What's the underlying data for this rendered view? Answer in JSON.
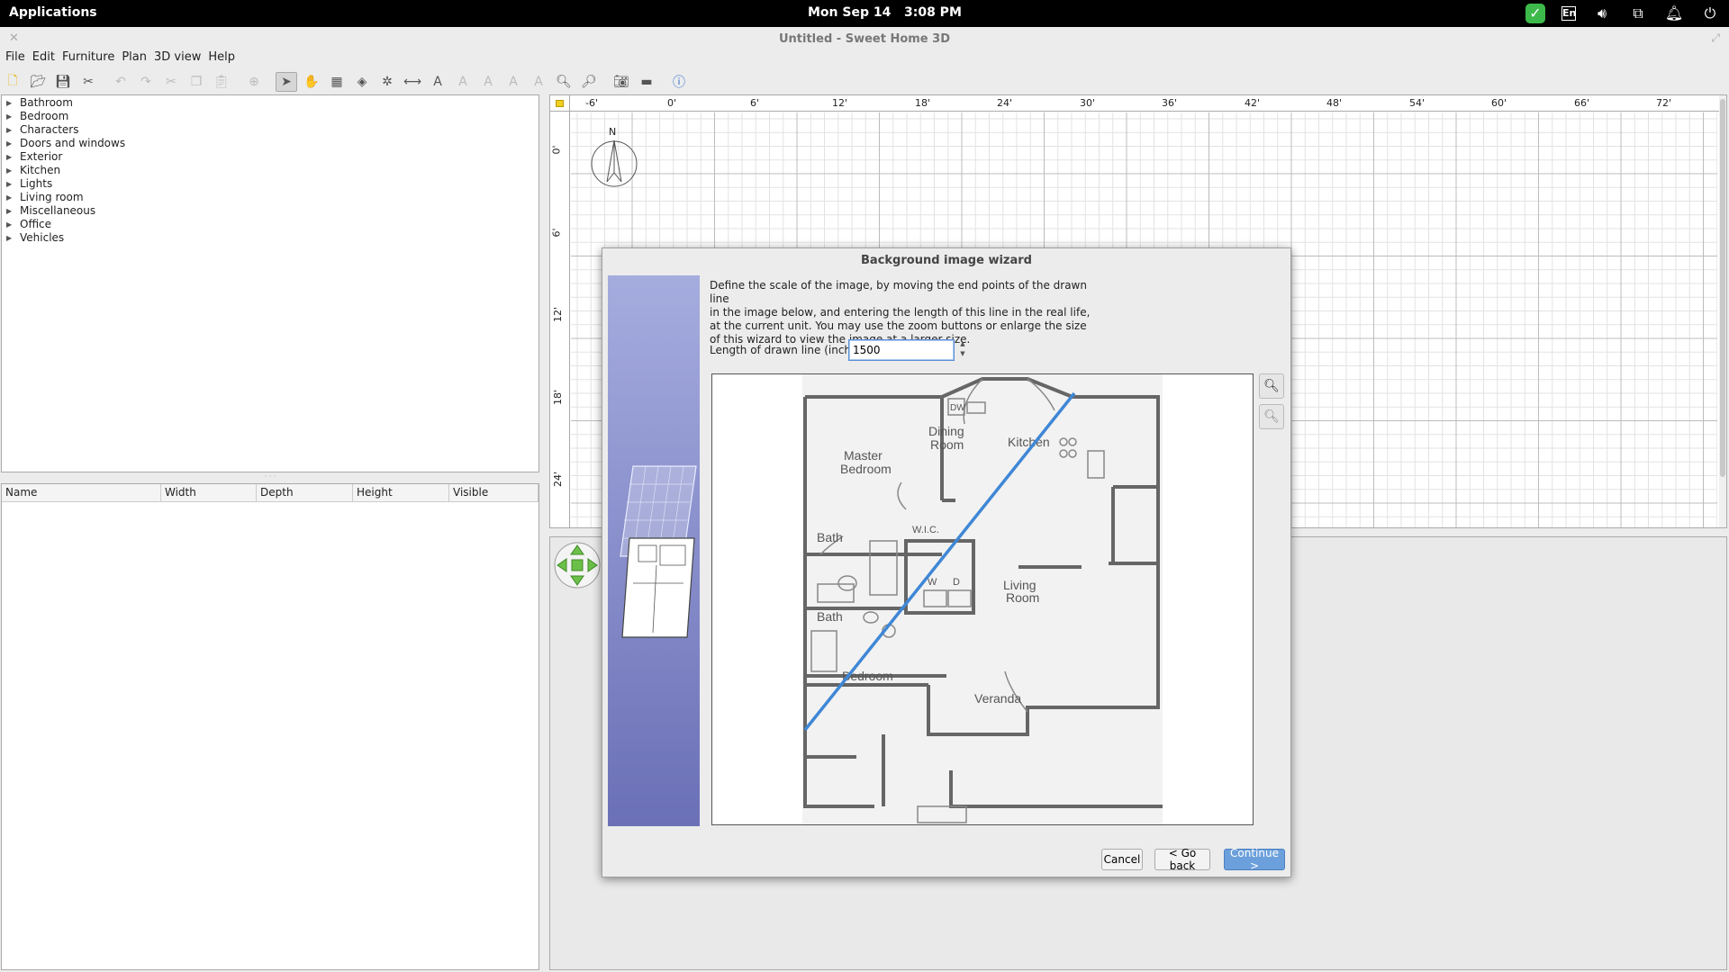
{
  "topbar": {
    "applications": "Applications",
    "date": "Mon Sep 14",
    "time": "3:08 PM",
    "lang": "En"
  },
  "window": {
    "title": "Untitled - Sweet Home 3D"
  },
  "menu": [
    "File",
    "Edit",
    "Furniture",
    "Plan",
    "3D view",
    "Help"
  ],
  "catalog": {
    "categories": [
      "Bathroom",
      "Bedroom",
      "Characters",
      "Doors and windows",
      "Exterior",
      "Kitchen",
      "Lights",
      "Living room",
      "Miscellaneous",
      "Office",
      "Vehicles"
    ]
  },
  "furniture_table": {
    "columns": [
      "Name",
      "Width",
      "Depth",
      "Height",
      "Visible"
    ]
  },
  "plan": {
    "ruler_top": [
      "-6'",
      "0'",
      "6'",
      "12'",
      "18'",
      "24'",
      "30'",
      "36'",
      "42'",
      "48'",
      "54'",
      "60'",
      "66'",
      "72'"
    ],
    "ruler_left": [
      "0'",
      "6'",
      "12'",
      "18'",
      "24'"
    ],
    "compass": "N"
  },
  "dialog": {
    "title": "Background image wizard",
    "instructions": [
      "Define the scale of the image, by moving the end points of the drawn line",
      "in the image below, and entering the length of this line in the real life,",
      "at the current unit. You may use the zoom buttons or enlarge the size",
      "of this wizard to view the image at a larger size."
    ],
    "length_label": "Length of drawn line (inch):",
    "length_value": "1500",
    "cancel": "Cancel",
    "back": "< Go back",
    "continue": "Continue >"
  },
  "floorplan": {
    "rooms": [
      "Master",
      "Bedroom",
      "Dining",
      "Room",
      "Kitchen",
      "DW",
      "W.I.C.",
      "Bath",
      "Bath",
      "W",
      "D",
      "Living",
      "Room",
      "Bedroom",
      "Veranda"
    ]
  },
  "colors": {
    "accent": "#4a8ad4",
    "scale_line": "#3f87d6",
    "dialog_side": "#8a90cc"
  }
}
